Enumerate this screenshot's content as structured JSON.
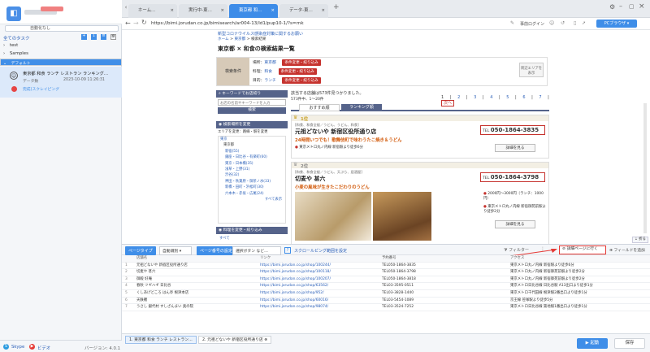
{
  "sidebar": {
    "new_task_label": "自動化なし",
    "task_tool_label": "全てのタスク",
    "tree": [
      "test",
      "Samples",
      "デフォルト"
    ],
    "task": {
      "title": "東京都 和食 ランチ レストラン ランキング…",
      "meta_label": "データ数",
      "meta_time": "2023-10-09 11:26:31",
      "status": "完成(スクレイピング"
    },
    "footer": {
      "skype_label": "Skype",
      "video_label": "ビデオ",
      "version": "バージョン: 4.0.1"
    }
  },
  "browser": {
    "tabs": [
      "ホーム…",
      "実行中-東…",
      "東京都 和…",
      "データ-東…"
    ],
    "url": "https://bimi.jorudan.co.jp/bimisearch/ar004-13/ld1/pup10-1/?s=rnk",
    "login_label": "事前ログイン",
    "pc_label": "PCブラウザ"
  },
  "site": {
    "notice": "新型コロナウイルス感染症対策に関するお願い",
    "breadcrumb": [
      "ホーム",
      "東京都",
      "検索結果"
    ],
    "heading": "東京都 × 和食の検索結果一覧",
    "cond_title": "検索条件",
    "cond_rows": [
      {
        "label": "場所：",
        "value": "東京都",
        "btn": "条件変更・絞り込み"
      },
      {
        "label": "料理：",
        "value": "和食",
        "btn": "条件変更・絞り込み"
      },
      {
        "label": "目的：",
        "value": "ランチ",
        "btn": "条件変更・絞り込み"
      }
    ],
    "area_btn": "周辺エリアを表示",
    "kw_title": "キーワードでお店絞り",
    "kw_placeholder": "お店の名前やキーワードを入力",
    "kw_btn": "検索",
    "place_title": "検索場所を変更",
    "area_change": "エリアを変更：路線・駅を変更",
    "area_links": [
      "東京",
      "東京都",
      "新宿(55)",
      "銀座・日比谷・有楽町(60)",
      "東京・日本橋(35)",
      "浅草・上野(31)",
      "渋谷(32)",
      "神田・秋葉原・御茶ノ水(33)",
      "新橋・田町・浜松町(30)",
      "六本木・赤坂・広尾(24)"
    ],
    "show_all": "すべて表示",
    "cuisine_title": "料理を変更・絞り込み",
    "cuisine_all": "すべて",
    "result_text": "該当する店舗は573件見つかりました。",
    "range_text": "573件中、1〜20件",
    "pages": [
      "1",
      "2",
      "3",
      "4",
      "5",
      "6",
      "7",
      "次へ"
    ],
    "sort_tabs": [
      "おすすめ順",
      "ランキング順"
    ],
    "shops": [
      {
        "rank": "1位",
        "category": "[和食、和食全般／うどん、うどん、和食]",
        "name": "元祖どないや 新宿区役所通り店",
        "catch": "24時間いつでも！歌舞伎町で味わうたこ焼き＆うどん",
        "access": "東京メトロ丸ノ内線 新宿駅より徒歩6分",
        "tel": "050-1864-3835",
        "detail": "詳細を見る"
      },
      {
        "rank": "2位",
        "category": "[和食、和食全般／うどん、天ぷら、居酒屋]",
        "name": "切麦や 甚六",
        "catch": "小麦の風味が生きたこだわりのうどん",
        "budget": "2000円〜3000円（ランチ：1000円）",
        "access": "東京メトロ丸ノ内線 新宿御苑前駅より徒歩2分",
        "tel": "050-1864-3798",
        "detail": "詳細を見る"
      }
    ]
  },
  "extractor": {
    "page_type_label": "ページタイプ",
    "page_type_value": "自動識別",
    "page_num_label": "ページ番号の設定",
    "page_num_value": "選択ボタン など…",
    "scroll_link": "スクロールピング範囲を設定",
    "filter_label": "フィルター",
    "detail_btn": "詳細ページに行く",
    "field_label": "フィールドを追加",
    "fold_label": "折る",
    "columns": [
      "店舗名",
      "リンク",
      "予約番号",
      "アクセス"
    ],
    "rows": [
      [
        "1",
        "元祖どないや 新宿区役所通り店",
        "https://bimi.jorudan.co.jp/shop/100244/",
        "TEL050-1864-3835",
        "東京メトロ丸ノ内線 新宿駅より徒歩6分"
      ],
      [
        "2",
        "切麦や 甚六",
        "https://bimi.jorudan.co.jp/shop/100118/",
        "TEL050-1864-3798",
        "東京メトロ丸ノ内線 新宿御苑前駅より徒歩2分"
      ],
      [
        "3",
        "御殿 好庵",
        "https://bimi.jorudan.co.jp/shop/100207/",
        "TEL050-1864-3818",
        "東京メトロ丸ノ内線 新宿御苑前駅より徒歩2分"
      ],
      [
        "4",
        "春秋 ツギハギ 日比谷",
        "https://bimi.jorudan.co.jp/shop/63562/",
        "TEL03-3595-0511",
        "東京メトロ日比谷線 日比谷駅 A13出口より徒歩1分"
      ],
      [
        "5",
        "くしあげどころ はん亭 根津本店",
        "https://bimi.jorudan.co.jp/shop/952/",
        "TEL03-3828-1440",
        "東京メトロ千代田線 根津駅2番出口より徒歩1分"
      ],
      [
        "6",
        "天麩羅",
        "https://bimi.jorudan.co.jp/shop/60016/",
        "TEL03-5454-1089",
        "京王線 笹塚駅より徒歩5分"
      ],
      [
        "7",
        "うさし 銀代村 すしざんまい 奥の院",
        "https://bimi.jorudan.co.jp/shop/98074/",
        "TEL03-3524-7252",
        "東京メトロ日比谷線 築地駅1番出口より徒歩1分"
      ]
    ],
    "bottom_tabs": [
      "1. 東京都 和食 ランチ レストラン…",
      "2. 元祖どないや 新宿区役所通り店"
    ],
    "run_btn": "起動",
    "save_btn": "保存"
  }
}
